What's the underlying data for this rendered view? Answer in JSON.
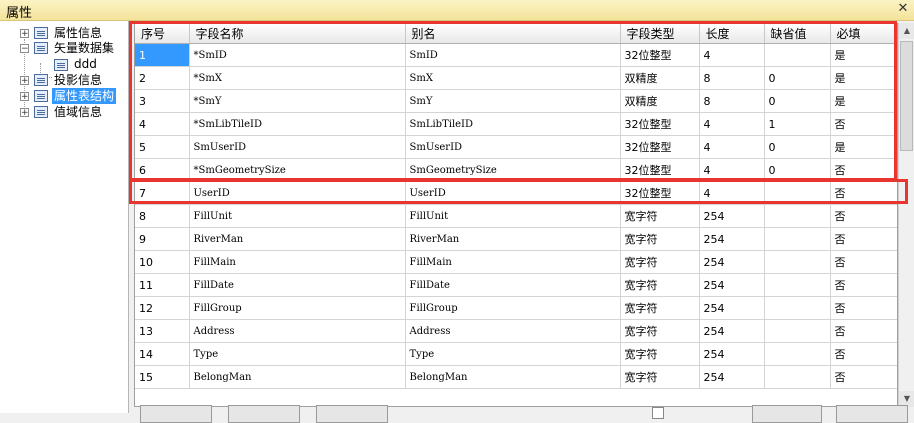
{
  "window": {
    "title": "属性",
    "close_label": "✕"
  },
  "tree": {
    "items": [
      {
        "label": "属性信息"
      },
      {
        "label": "矢量数据集"
      },
      {
        "label": "ddd"
      },
      {
        "label": "投影信息"
      },
      {
        "label": "属性表结构",
        "selected": true
      },
      {
        "label": "值域信息"
      }
    ]
  },
  "table": {
    "headers": [
      "序号",
      "字段名称",
      "别名",
      "字段类型",
      "长度",
      "缺省值",
      "必填"
    ],
    "rows": [
      [
        "1",
        "*SmID",
        "SmID",
        "32位整型",
        "4",
        "",
        "是"
      ],
      [
        "2",
        "*SmX",
        "SmX",
        "双精度",
        "8",
        "0",
        "是"
      ],
      [
        "3",
        "*SmY",
        "SmY",
        "双精度",
        "8",
        "0",
        "是"
      ],
      [
        "4",
        "*SmLibTileID",
        "SmLibTileID",
        "32位整型",
        "4",
        "1",
        "否"
      ],
      [
        "5",
        "SmUserID",
        "SmUserID",
        "32位整型",
        "4",
        "0",
        "是"
      ],
      [
        "6",
        "*SmGeometrySize",
        "SmGeometrySize",
        "32位整型",
        "4",
        "0",
        "否"
      ],
      [
        "7",
        "UserID",
        "UserID",
        "32位整型",
        "4",
        "",
        "否"
      ],
      [
        "8",
        "FillUnit",
        "FillUnit",
        "宽字符",
        "254",
        "",
        "否"
      ],
      [
        "9",
        "RiverMan",
        "RiverMan",
        "宽字符",
        "254",
        "",
        "否"
      ],
      [
        "10",
        "FillMain",
        "FillMain",
        "宽字符",
        "254",
        "",
        "否"
      ],
      [
        "11",
        "FillDate",
        "FillDate",
        "宽字符",
        "254",
        "",
        "否"
      ],
      [
        "12",
        "FillGroup",
        "FillGroup",
        "宽字符",
        "254",
        "",
        "否"
      ],
      [
        "13",
        "Address",
        "Address",
        "宽字符",
        "254",
        "",
        "否"
      ],
      [
        "14",
        "Type",
        "Type",
        "宽字符",
        "254",
        "",
        "否"
      ],
      [
        "15",
        "BelongMan",
        "BelongMan",
        "宽字符",
        "254",
        "",
        "否"
      ]
    ]
  },
  "colors": {
    "highlight": "#e8352f",
    "selection": "#3399ff"
  }
}
